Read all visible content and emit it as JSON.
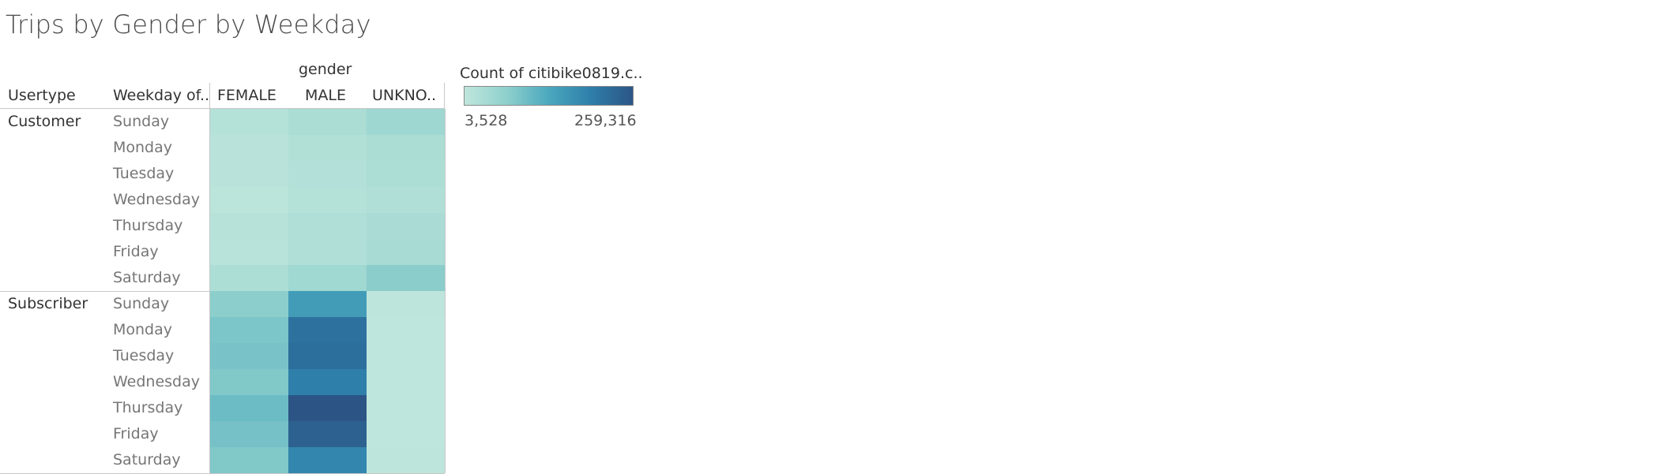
{
  "chart_data": {
    "type": "heatmap",
    "title": "Trips by Gender by Weekday",
    "column_header": "gender",
    "row_headers": [
      "Usertype",
      "Weekday of.."
    ],
    "columns": [
      "FEMALE",
      "MALE",
      "UNKNO.."
    ],
    "weekdays": [
      "Sunday",
      "Monday",
      "Tuesday",
      "Wednesday",
      "Thursday",
      "Friday",
      "Saturday"
    ],
    "groups": [
      {
        "name": "Customer",
        "values": [
          [
            18000,
            30000,
            48000
          ],
          [
            12000,
            22000,
            30000
          ],
          [
            11000,
            20000,
            28000
          ],
          [
            9000,
            18000,
            24000
          ],
          [
            14000,
            24000,
            32000
          ],
          [
            13000,
            25000,
            35000
          ],
          [
            27000,
            45000,
            72000
          ]
        ]
      },
      {
        "name": "Subscriber",
        "values": [
          [
            70000,
            150000,
            5000
          ],
          [
            85000,
            215000,
            4500
          ],
          [
            88000,
            220000,
            4000
          ],
          [
            80000,
            195000,
            4200
          ],
          [
            100000,
            259316,
            3800
          ],
          [
            92000,
            240000,
            3528
          ],
          [
            80000,
            185000,
            5000
          ]
        ]
      }
    ],
    "legend": {
      "title": "Count of citibike0819.c..",
      "min": 3528,
      "max": 259316,
      "min_label": "3,528",
      "max_label": "259,316",
      "colors": [
        "#bfe6dc",
        "#8fd0cc",
        "#4aa8be",
        "#2e7faa",
        "#2c5585"
      ]
    }
  }
}
